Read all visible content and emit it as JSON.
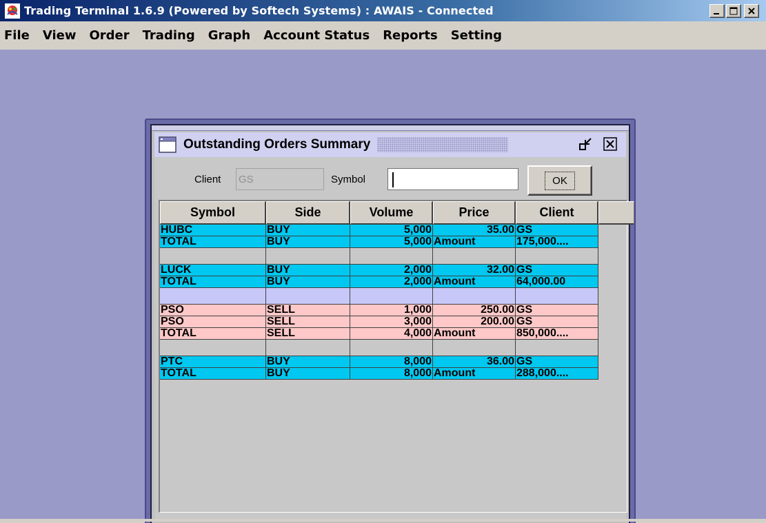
{
  "window": {
    "title": "Trading Terminal 1.6.9 (Powered by Softech Systems)   :   AWAIS - Connected"
  },
  "menu": [
    "File",
    "View",
    "Order",
    "Trading",
    "Graph",
    "Account Status",
    "Reports",
    "Setting"
  ],
  "frame": {
    "title": "Outstanding Orders Summary"
  },
  "filters": {
    "client_label": "Client",
    "client_value": "GS",
    "symbol_label": "Symbol",
    "symbol_value": "",
    "ok_label": "OK"
  },
  "table": {
    "headers": [
      "Symbol",
      "Side",
      "Volume",
      "Price",
      "Client"
    ],
    "rows": [
      {
        "style": "blue",
        "cells": [
          "HUBC",
          "BUY",
          "5,000",
          "35.00",
          "GS"
        ]
      },
      {
        "style": "blue",
        "cells": [
          "TOTAL",
          "BUY",
          "5,000",
          "Amount",
          "175,000...."
        ]
      },
      {
        "style": "grey",
        "cells": [
          "",
          "",
          "",
          "",
          ""
        ]
      },
      {
        "style": "blue",
        "cells": [
          "LUCK",
          "BUY",
          "2,000",
          "32.00",
          "GS"
        ]
      },
      {
        "style": "blue",
        "cells": [
          "TOTAL",
          "BUY",
          "2,000",
          "Amount",
          "64,000.00"
        ]
      },
      {
        "style": "lav",
        "cells": [
          "",
          "",
          "",
          "",
          ""
        ]
      },
      {
        "style": "pink",
        "cells": [
          "PSO",
          "SELL",
          "1,000",
          "250.00",
          "GS"
        ]
      },
      {
        "style": "pink",
        "cells": [
          "PSO",
          "SELL",
          "3,000",
          "200.00",
          "GS"
        ]
      },
      {
        "style": "pink",
        "cells": [
          "TOTAL",
          "SELL",
          "4,000",
          "Amount",
          "850,000...."
        ]
      },
      {
        "style": "grey",
        "cells": [
          "",
          "",
          "",
          "",
          ""
        ]
      },
      {
        "style": "blue",
        "cells": [
          "PTC",
          "BUY",
          "8,000",
          "36.00",
          "GS"
        ]
      },
      {
        "style": "blue",
        "cells": [
          "TOTAL",
          "BUY",
          "8,000",
          "Amount",
          "288,000...."
        ]
      }
    ]
  },
  "colors": {
    "buy_row": "#00c8f0",
    "sell_row": "#ffc8c8",
    "separator_lavender": "#c8c8f8",
    "desktop": "#9a9ac8"
  }
}
